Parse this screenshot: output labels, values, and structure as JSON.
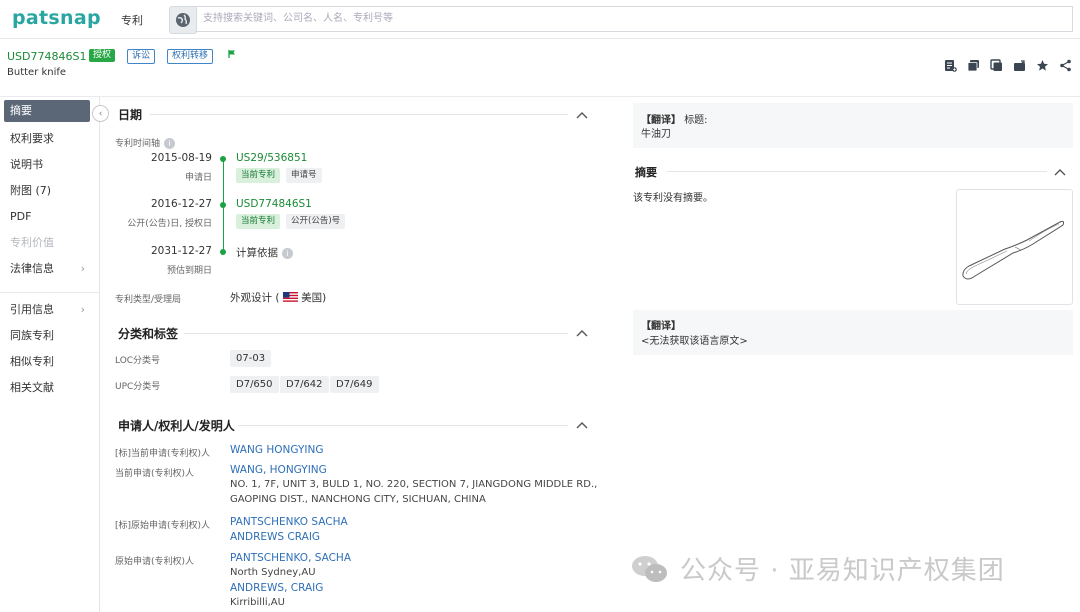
{
  "app": {
    "logo": "patsnap",
    "nav_label": "专利"
  },
  "search": {
    "placeholder": "支持搜索关键词、公司名、人名、专利号等"
  },
  "header": {
    "patent_number": "USD774846S1",
    "tags": [
      "授权",
      "诉讼",
      "权利转移"
    ],
    "title": "Butter knife",
    "tool_icons": [
      "note-add-icon",
      "folder-icon",
      "copy-icon",
      "share-out-icon",
      "star-icon",
      "share-icon"
    ]
  },
  "sidebar": {
    "group1": [
      {
        "label": "摘要",
        "active": true
      },
      {
        "label": "权利要求"
      },
      {
        "label": "说明书"
      },
      {
        "label": "附图 (7)"
      },
      {
        "label": "PDF"
      },
      {
        "label": "专利价值",
        "disabled": true
      },
      {
        "label": "法律信息",
        "chevron": true
      }
    ],
    "group2": [
      {
        "label": "引用信息",
        "chevron": true
      },
      {
        "label": "同族专利"
      },
      {
        "label": "相似专利"
      },
      {
        "label": "相关文献"
      }
    ]
  },
  "dates": {
    "section_title": "日期",
    "timeline_label": "专利时间轴",
    "entries": [
      {
        "date": "2015-08-19",
        "sub": "申请日",
        "link": "US29/536851",
        "chips": [
          "当前专利",
          "申请号"
        ]
      },
      {
        "date": "2016-12-27",
        "sub": "公开(公告)日, 授权日",
        "link": "USD774846S1",
        "chips": [
          "当前专利",
          "公开(公告)号"
        ]
      },
      {
        "date": "2031-12-27",
        "sub": "预估到期日",
        "note": "计算依据"
      }
    ],
    "type_label": "专利类型/受理局",
    "type_value": "外观设计 (",
    "country": "美国",
    "type_close": ")"
  },
  "classification": {
    "section_title": "分类和标签",
    "loc_label": "LOC分类号",
    "loc_values": [
      "07-03"
    ],
    "upc_label": "UPC分类号",
    "upc_values": [
      "D7/650",
      "D7/642",
      "D7/649"
    ]
  },
  "applicants": {
    "section_title": "申请人/权利人/发明人",
    "rows": [
      {
        "label": "[标]当前申请(专利权)人",
        "names": [
          "WANG HONGYING"
        ],
        "addr": []
      },
      {
        "label": "当前申请(专利权)人",
        "names": [
          "WANG, HONGYING"
        ],
        "addr": [
          "NO. 1, 7F, UNIT 3, BULD 1, NO. 220, SECTION 7, JIANGDONG MIDDLE RD.,",
          "GAOPING DIST., NANCHONG CITY, SICHUAN, CHINA"
        ]
      },
      {
        "label": "[标]原始申请(专利权)人",
        "names": [
          "PANTSCHENKO SACHA",
          "ANDREWS CRAIG"
        ],
        "addr": []
      },
      {
        "label": "原始申请(专利权)人",
        "names": [
          "PANTSCHENKO, SACHA"
        ],
        "addr": [
          "North Sydney,AU"
        ],
        "names2": [
          "ANDREWS, CRAIG"
        ],
        "addr2": [
          "Kirribilli,AU"
        ]
      }
    ]
  },
  "right": {
    "translate_tag": "【翻译】",
    "title_label": "标题:",
    "title_translation": "牛油刀",
    "abstract_title": "摘要",
    "abstract_text": "该专利没有摘要。",
    "translate_tag2": "【翻译】",
    "no_source": "<无法获取该语言原文>"
  },
  "watermark": {
    "text": "公众号 · 亚易知识产权集团"
  },
  "colors": {
    "brand": "#2aa6a0",
    "green": "#1aa243",
    "blue": "#2e6fb8",
    "sidebar_active": "#5b6677"
  }
}
